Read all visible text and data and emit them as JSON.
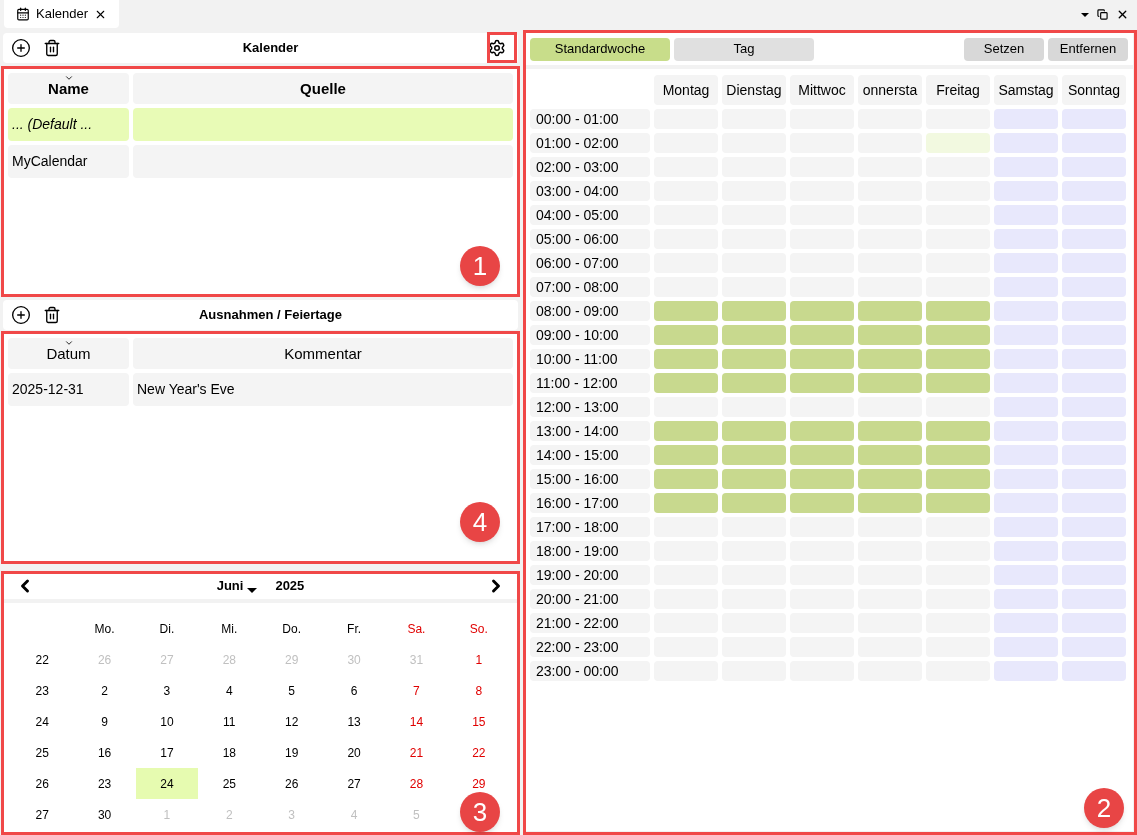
{
  "document_tab": {
    "title": "Kalender"
  },
  "calendars": {
    "title": "Kalender",
    "columns": [
      "Name",
      "Quelle"
    ],
    "rows": [
      {
        "cells": [
          "... (Default ..."
        ],
        "selected": true,
        "italic": true
      },
      {
        "cells": [
          "MyCalendar"
        ],
        "selected": false,
        "italic": false
      }
    ]
  },
  "exceptions": {
    "title": "Ausnahmen / Feiertage",
    "columns": [
      "Datum",
      "Kommentar"
    ],
    "rows": [
      {
        "cells": [
          "2025-12-31",
          "New Year's Eve"
        ],
        "selected": false
      }
    ]
  },
  "month_calendar": {
    "month": "Juni",
    "year": "2025",
    "weekdays": [
      {
        "label": "Mo.",
        "weekend": false
      },
      {
        "label": "Di.",
        "weekend": false
      },
      {
        "label": "Mi.",
        "weekend": false
      },
      {
        "label": "Do.",
        "weekend": false
      },
      {
        "label": "Fr.",
        "weekend": false
      },
      {
        "label": "Sa.",
        "weekend": true
      },
      {
        "label": "So.",
        "weekend": true
      }
    ],
    "weeks": [
      {
        "number": "22",
        "days": [
          {
            "day": "26",
            "muted": true,
            "selected": false
          },
          {
            "day": "27",
            "muted": true,
            "selected": false
          },
          {
            "day": "28",
            "muted": true,
            "selected": false
          },
          {
            "day": "29",
            "muted": true,
            "selected": false
          },
          {
            "day": "30",
            "muted": true,
            "selected": false
          },
          {
            "day": "31",
            "muted": true,
            "selected": false
          },
          {
            "day": "1",
            "muted": false,
            "selected": false
          }
        ]
      },
      {
        "number": "23",
        "days": [
          {
            "day": "2",
            "muted": false,
            "selected": false
          },
          {
            "day": "3",
            "muted": false,
            "selected": false
          },
          {
            "day": "4",
            "muted": false,
            "selected": false
          },
          {
            "day": "5",
            "muted": false,
            "selected": false
          },
          {
            "day": "6",
            "muted": false,
            "selected": false
          },
          {
            "day": "7",
            "muted": false,
            "selected": false
          },
          {
            "day": "8",
            "muted": false,
            "selected": false
          }
        ]
      },
      {
        "number": "24",
        "days": [
          {
            "day": "9",
            "muted": false,
            "selected": false
          },
          {
            "day": "10",
            "muted": false,
            "selected": false
          },
          {
            "day": "11",
            "muted": false,
            "selected": false
          },
          {
            "day": "12",
            "muted": false,
            "selected": false
          },
          {
            "day": "13",
            "muted": false,
            "selected": false
          },
          {
            "day": "14",
            "muted": false,
            "selected": false
          },
          {
            "day": "15",
            "muted": false,
            "selected": false
          }
        ]
      },
      {
        "number": "25",
        "days": [
          {
            "day": "16",
            "muted": false,
            "selected": false
          },
          {
            "day": "17",
            "muted": false,
            "selected": false
          },
          {
            "day": "18",
            "muted": false,
            "selected": false
          },
          {
            "day": "19",
            "muted": false,
            "selected": false
          },
          {
            "day": "20",
            "muted": false,
            "selected": false
          },
          {
            "day": "21",
            "muted": false,
            "selected": false
          },
          {
            "day": "22",
            "muted": false,
            "selected": false
          }
        ]
      },
      {
        "number": "26",
        "days": [
          {
            "day": "23",
            "muted": false,
            "selected": false
          },
          {
            "day": "24",
            "muted": false,
            "selected": true
          },
          {
            "day": "25",
            "muted": false,
            "selected": false
          },
          {
            "day": "26",
            "muted": false,
            "selected": false
          },
          {
            "day": "27",
            "muted": false,
            "selected": false
          },
          {
            "day": "28",
            "muted": false,
            "selected": false
          },
          {
            "day": "29",
            "muted": false,
            "selected": false
          }
        ]
      },
      {
        "number": "27",
        "days": [
          {
            "day": "30",
            "muted": false,
            "selected": false
          },
          {
            "day": "1",
            "muted": true,
            "selected": false
          },
          {
            "day": "2",
            "muted": true,
            "selected": false
          },
          {
            "day": "3",
            "muted": true,
            "selected": false
          },
          {
            "day": "4",
            "muted": true,
            "selected": false
          },
          {
            "day": "5",
            "muted": true,
            "selected": false
          }
        ]
      }
    ]
  },
  "week_schedule": {
    "tabs": [
      {
        "label": "Standardwoche",
        "selected": true
      },
      {
        "label": "Tag",
        "selected": false
      }
    ],
    "buttons": [
      "Setzen",
      "Entfernen"
    ],
    "days": [
      "Montag",
      "Dienstag",
      "Mittwoc",
      "onnersta",
      "Freitag",
      "Samstag",
      "Sonntag"
    ],
    "rows": [
      {
        "time": "00:00 - 01:00",
        "cells": [
          {
            "kind": "free"
          },
          {
            "kind": "free"
          },
          {
            "kind": "free"
          },
          {
            "kind": "free"
          },
          {
            "kind": "free"
          },
          {
            "kind": "weekend"
          },
          {
            "kind": "weekend"
          }
        ]
      },
      {
        "time": "01:00 - 02:00",
        "cells": [
          {
            "kind": "free"
          },
          {
            "kind": "free"
          },
          {
            "kind": "free"
          },
          {
            "kind": "free"
          },
          {
            "kind": "selected"
          },
          {
            "kind": "weekend"
          },
          {
            "kind": "weekend"
          }
        ]
      },
      {
        "time": "02:00 - 03:00",
        "cells": [
          {
            "kind": "free"
          },
          {
            "kind": "free"
          },
          {
            "kind": "free"
          },
          {
            "kind": "free"
          },
          {
            "kind": "free"
          },
          {
            "kind": "weekend"
          },
          {
            "kind": "weekend"
          }
        ]
      },
      {
        "time": "03:00 - 04:00",
        "cells": [
          {
            "kind": "free"
          },
          {
            "kind": "free"
          },
          {
            "kind": "free"
          },
          {
            "kind": "free"
          },
          {
            "kind": "free"
          },
          {
            "kind": "weekend"
          },
          {
            "kind": "weekend"
          }
        ]
      },
      {
        "time": "04:00 - 05:00",
        "cells": [
          {
            "kind": "free"
          },
          {
            "kind": "free"
          },
          {
            "kind": "free"
          },
          {
            "kind": "free"
          },
          {
            "kind": "free"
          },
          {
            "kind": "weekend"
          },
          {
            "kind": "weekend"
          }
        ]
      },
      {
        "time": "05:00 - 06:00",
        "cells": [
          {
            "kind": "free"
          },
          {
            "kind": "free"
          },
          {
            "kind": "free"
          },
          {
            "kind": "free"
          },
          {
            "kind": "free"
          },
          {
            "kind": "weekend"
          },
          {
            "kind": "weekend"
          }
        ]
      },
      {
        "time": "06:00 - 07:00",
        "cells": [
          {
            "kind": "free"
          },
          {
            "kind": "free"
          },
          {
            "kind": "free"
          },
          {
            "kind": "free"
          },
          {
            "kind": "free"
          },
          {
            "kind": "weekend"
          },
          {
            "kind": "weekend"
          }
        ]
      },
      {
        "time": "07:00 - 08:00",
        "cells": [
          {
            "kind": "free"
          },
          {
            "kind": "free"
          },
          {
            "kind": "free"
          },
          {
            "kind": "free"
          },
          {
            "kind": "free"
          },
          {
            "kind": "weekend"
          },
          {
            "kind": "weekend"
          }
        ]
      },
      {
        "time": "08:00 - 09:00",
        "cells": [
          {
            "kind": "work"
          },
          {
            "kind": "work"
          },
          {
            "kind": "work"
          },
          {
            "kind": "work"
          },
          {
            "kind": "work"
          },
          {
            "kind": "weekend"
          },
          {
            "kind": "weekend"
          }
        ]
      },
      {
        "time": "09:00 - 10:00",
        "cells": [
          {
            "kind": "work"
          },
          {
            "kind": "work"
          },
          {
            "kind": "work"
          },
          {
            "kind": "work"
          },
          {
            "kind": "work"
          },
          {
            "kind": "weekend"
          },
          {
            "kind": "weekend"
          }
        ]
      },
      {
        "time": "10:00 - 11:00",
        "cells": [
          {
            "kind": "work"
          },
          {
            "kind": "work"
          },
          {
            "kind": "work"
          },
          {
            "kind": "work"
          },
          {
            "kind": "work"
          },
          {
            "kind": "weekend"
          },
          {
            "kind": "weekend"
          }
        ]
      },
      {
        "time": "11:00 - 12:00",
        "cells": [
          {
            "kind": "work"
          },
          {
            "kind": "work"
          },
          {
            "kind": "work"
          },
          {
            "kind": "work"
          },
          {
            "kind": "work"
          },
          {
            "kind": "weekend"
          },
          {
            "kind": "weekend"
          }
        ]
      },
      {
        "time": "12:00 - 13:00",
        "cells": [
          {
            "kind": "free"
          },
          {
            "kind": "free"
          },
          {
            "kind": "free"
          },
          {
            "kind": "free"
          },
          {
            "kind": "free"
          },
          {
            "kind": "weekend"
          },
          {
            "kind": "weekend"
          }
        ]
      },
      {
        "time": "13:00 - 14:00",
        "cells": [
          {
            "kind": "work"
          },
          {
            "kind": "work"
          },
          {
            "kind": "work"
          },
          {
            "kind": "work"
          },
          {
            "kind": "work"
          },
          {
            "kind": "weekend"
          },
          {
            "kind": "weekend"
          }
        ]
      },
      {
        "time": "14:00 - 15:00",
        "cells": [
          {
            "kind": "work"
          },
          {
            "kind": "work"
          },
          {
            "kind": "work"
          },
          {
            "kind": "work"
          },
          {
            "kind": "work"
          },
          {
            "kind": "weekend"
          },
          {
            "kind": "weekend"
          }
        ]
      },
      {
        "time": "15:00 - 16:00",
        "cells": [
          {
            "kind": "work"
          },
          {
            "kind": "work"
          },
          {
            "kind": "work"
          },
          {
            "kind": "work"
          },
          {
            "kind": "work"
          },
          {
            "kind": "weekend"
          },
          {
            "kind": "weekend"
          }
        ]
      },
      {
        "time": "16:00 - 17:00",
        "cells": [
          {
            "kind": "work"
          },
          {
            "kind": "work"
          },
          {
            "kind": "work"
          },
          {
            "kind": "work"
          },
          {
            "kind": "work"
          },
          {
            "kind": "weekend"
          },
          {
            "kind": "weekend"
          }
        ]
      },
      {
        "time": "17:00 - 18:00",
        "cells": [
          {
            "kind": "free"
          },
          {
            "kind": "free"
          },
          {
            "kind": "free"
          },
          {
            "kind": "free"
          },
          {
            "kind": "free"
          },
          {
            "kind": "weekend"
          },
          {
            "kind": "weekend"
          }
        ]
      },
      {
        "time": "18:00 - 19:00",
        "cells": [
          {
            "kind": "free"
          },
          {
            "kind": "free"
          },
          {
            "kind": "free"
          },
          {
            "kind": "free"
          },
          {
            "kind": "free"
          },
          {
            "kind": "weekend"
          },
          {
            "kind": "weekend"
          }
        ]
      },
      {
        "time": "19:00 - 20:00",
        "cells": [
          {
            "kind": "free"
          },
          {
            "kind": "free"
          },
          {
            "kind": "free"
          },
          {
            "kind": "free"
          },
          {
            "kind": "free"
          },
          {
            "kind": "weekend"
          },
          {
            "kind": "weekend"
          }
        ]
      },
      {
        "time": "20:00 - 21:00",
        "cells": [
          {
            "kind": "free"
          },
          {
            "kind": "free"
          },
          {
            "kind": "free"
          },
          {
            "kind": "free"
          },
          {
            "kind": "free"
          },
          {
            "kind": "weekend"
          },
          {
            "kind": "weekend"
          }
        ]
      },
      {
        "time": "21:00 - 22:00",
        "cells": [
          {
            "kind": "free"
          },
          {
            "kind": "free"
          },
          {
            "kind": "free"
          },
          {
            "kind": "free"
          },
          {
            "kind": "free"
          },
          {
            "kind": "weekend"
          },
          {
            "kind": "weekend"
          }
        ]
      },
      {
        "time": "22:00 - 23:00",
        "cells": [
          {
            "kind": "free"
          },
          {
            "kind": "free"
          },
          {
            "kind": "free"
          },
          {
            "kind": "free"
          },
          {
            "kind": "free"
          },
          {
            "kind": "weekend"
          },
          {
            "kind": "weekend"
          }
        ]
      },
      {
        "time": "23:00 - 00:00",
        "cells": [
          {
            "kind": "free"
          },
          {
            "kind": "free"
          },
          {
            "kind": "free"
          },
          {
            "kind": "free"
          },
          {
            "kind": "free"
          },
          {
            "kind": "weekend"
          },
          {
            "kind": "weekend"
          }
        ]
      }
    ]
  },
  "annotations": [
    "1",
    "4",
    "3",
    "2"
  ]
}
